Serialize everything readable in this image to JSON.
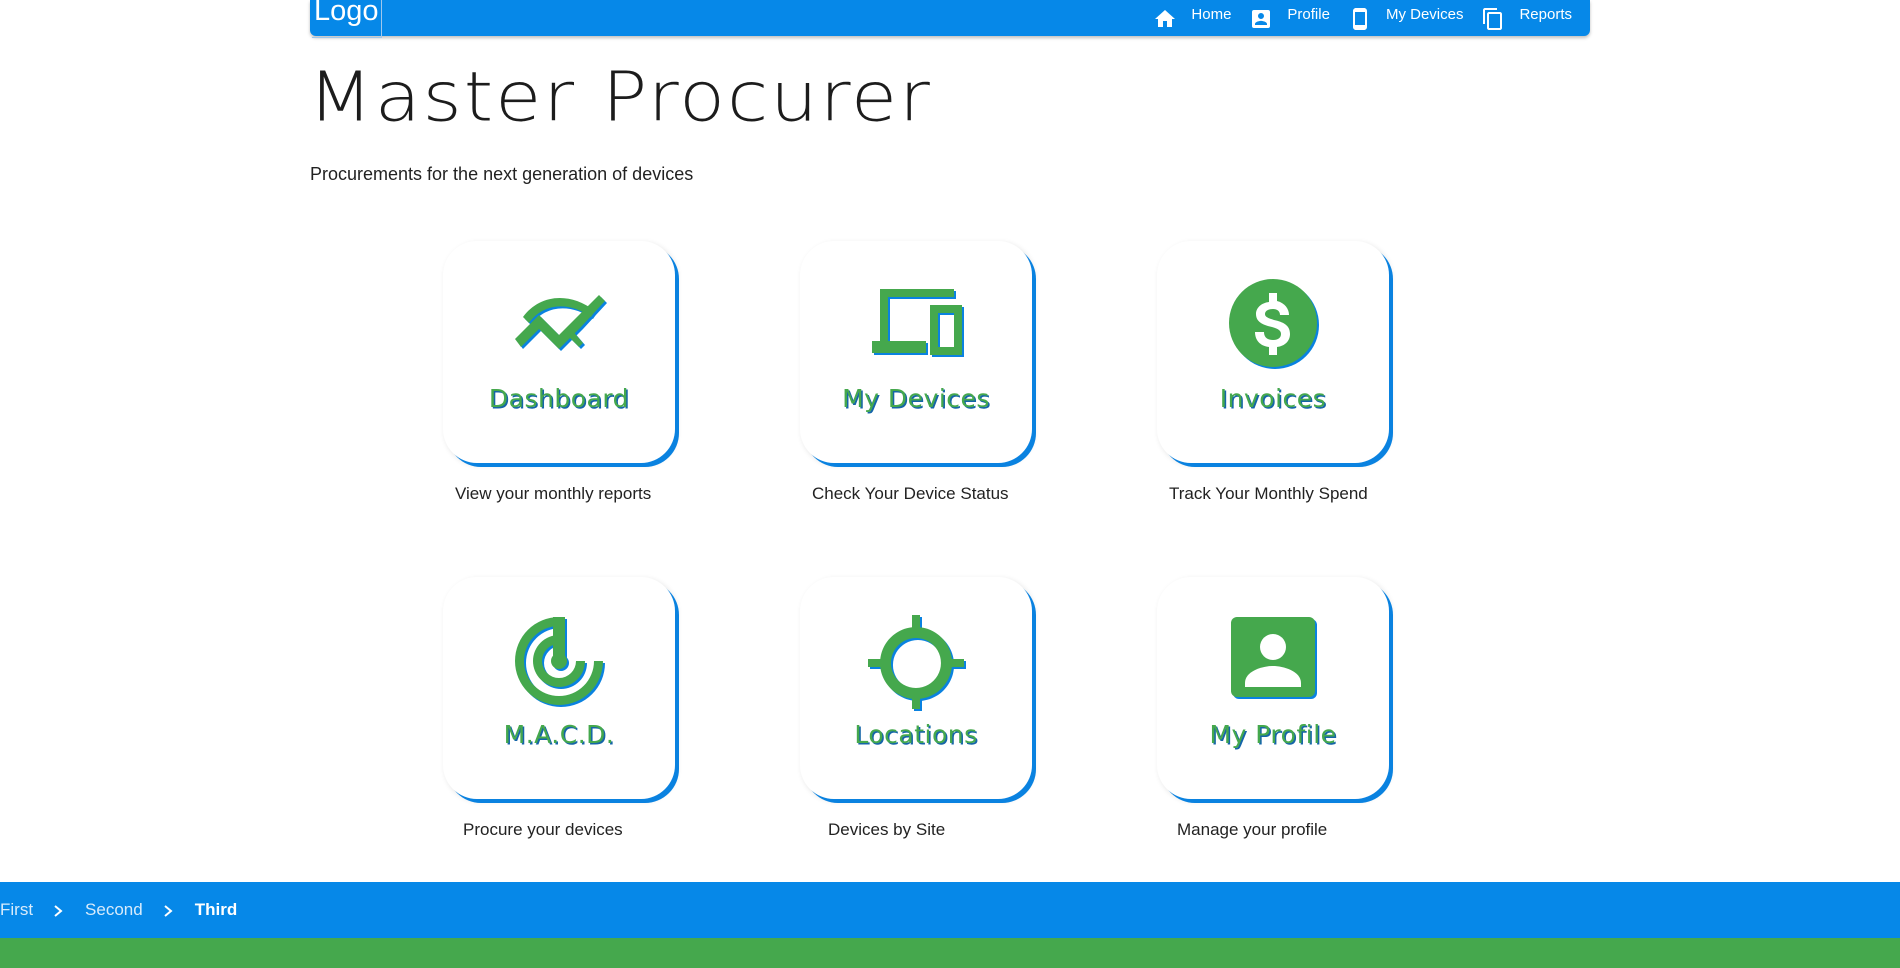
{
  "nav": {
    "logo": "Logo",
    "links": [
      {
        "label": "Home",
        "icon": "home-icon"
      },
      {
        "label": "Profile",
        "icon": "profile-icon"
      },
      {
        "label": "My Devices",
        "icon": "phone-icon"
      },
      {
        "label": "Reports",
        "icon": "copy-icon"
      }
    ]
  },
  "header": {
    "title": "Master Procurer",
    "subtitle": "Procurements for the next generation of devices"
  },
  "tiles": [
    {
      "label": "Dashboard",
      "caption": "View your monthly reports",
      "icon": "trending-up-icon"
    },
    {
      "label": "My Devices",
      "caption": "Check Your Device Status",
      "icon": "devices-icon"
    },
    {
      "label": "Invoices",
      "caption": "Track Your Monthly Spend",
      "icon": "dollar-icon"
    },
    {
      "label": "M.A.C.D.",
      "caption": "Procure your devices",
      "icon": "radar-icon"
    },
    {
      "label": "Locations",
      "caption": "Devices by Site",
      "icon": "crosshair-icon"
    },
    {
      "label": "My Profile",
      "caption": "Manage your profile",
      "icon": "account-box-icon"
    }
  ],
  "breadcrumb": {
    "items": [
      "First",
      "Second",
      "Third"
    ]
  },
  "colors": {
    "primary": "#0688e8",
    "accent": "#45a84d",
    "text": "#222222"
  }
}
